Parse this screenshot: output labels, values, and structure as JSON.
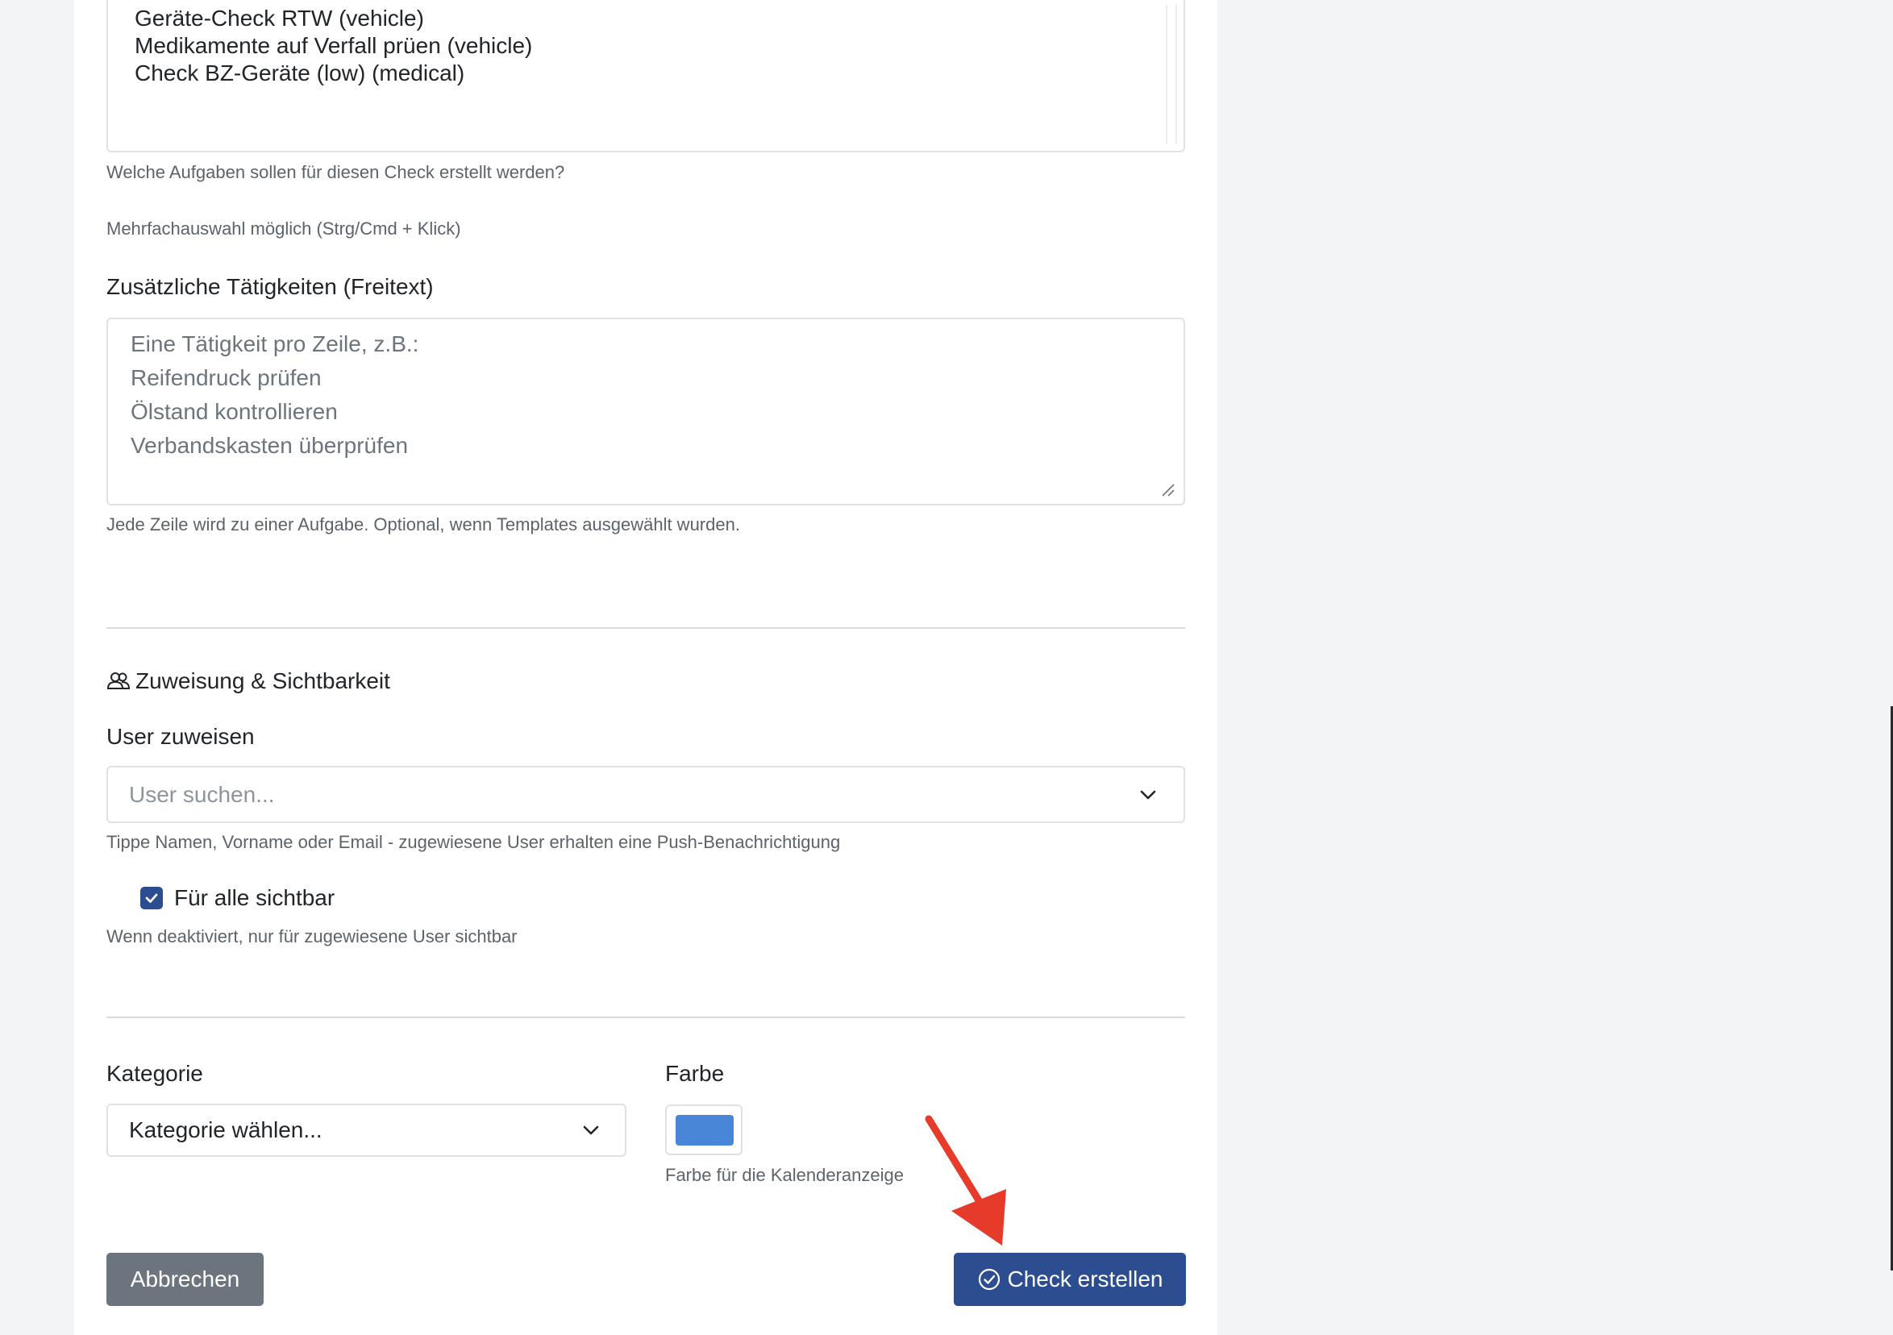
{
  "task_templates": {
    "options": [
      "Geräte-Check RTW (vehicle)",
      "Medikamente auf Verfall prüen (vehicle)",
      "Check BZ-Geräte (low) (medical)"
    ],
    "help_1": "Welche Aufgaben sollen für diesen Check erstellt werden?",
    "help_2": "Mehrfachauswahl möglich (Strg/Cmd + Klick)"
  },
  "additional_tasks": {
    "label": "Zusätzliche Tätigkeiten (Freitext)",
    "placeholder_lines": [
      "Eine Tätigkeit pro Zeile, z.B.:",
      "Reifendruck prüfen",
      "Ölstand kontrollieren",
      "Verbandskasten überprüfen"
    ],
    "help": "Jede Zeile wird zu einer Aufgabe. Optional, wenn Templates ausgewählt wurden."
  },
  "assignment": {
    "section_title": "Zuweisung & Sichtbarkeit",
    "section_icon": "users-icon",
    "user_label": "User zuweisen",
    "user_placeholder": "User suchen...",
    "user_help": "Tippe Namen, Vorname oder Email - zugewiesene User erhalten eine Push-Benachrichtigung",
    "visible_all_label": "Für alle sichtbar",
    "visible_all_checked": true,
    "visible_all_help": "Wenn deaktiviert, nur für zugewiesene User sichtbar"
  },
  "category": {
    "label": "Kategorie",
    "selected": "Kategorie wählen..."
  },
  "color": {
    "label": "Farbe",
    "value": "#4a86d8",
    "help": "Farbe für die Kalenderanzeige"
  },
  "actions": {
    "cancel_label": "Abbrechen",
    "submit_label": "Check erstellen",
    "submit_icon": "check-circle-icon"
  },
  "colors": {
    "primary": "#2c4d8f",
    "secondary": "#6c757d",
    "annotation_arrow": "#e63b2a"
  }
}
